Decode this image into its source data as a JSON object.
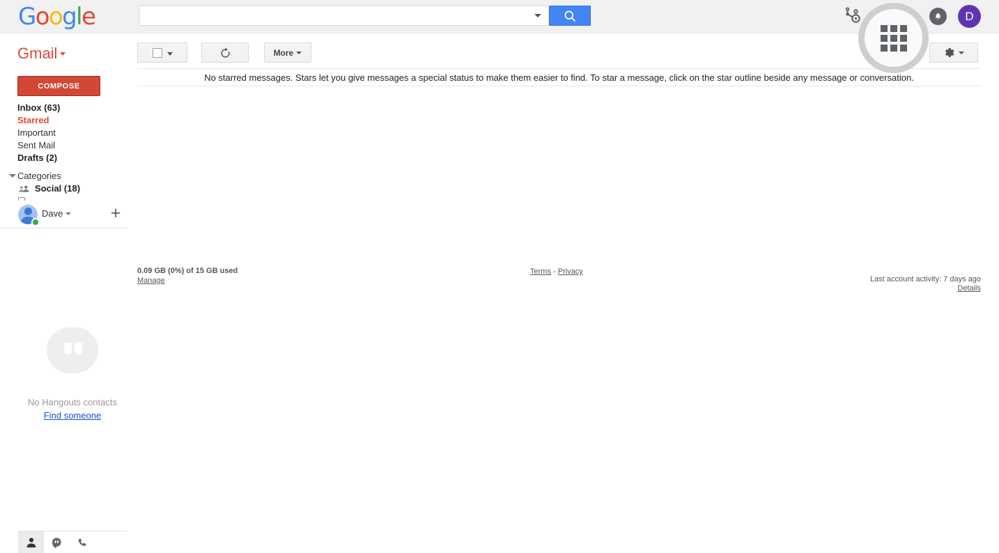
{
  "topbar": {
    "logo_text": "Google",
    "logo_letters": [
      "G",
      "o",
      "o",
      "g",
      "l",
      "e"
    ],
    "search": {
      "value": "",
      "placeholder": ""
    },
    "search_button_icon": "search-icon",
    "search_dropdown_icon": "chevron-down-icon",
    "hubspot_icon": "hubspot-sprocket-icon",
    "apps_icon": "apps-grid-icon",
    "notifications_icon": "bell-icon",
    "avatar_initial": "D",
    "accent_blue": "#4285f4",
    "avatar_color": "#5e35b1"
  },
  "brand": {
    "gmail_label": "Gmail",
    "gmail_color": "#dd4b39"
  },
  "toolbar": {
    "select_all_icon": "checkbox-icon",
    "select_all_caret": "chevron-down-icon",
    "refresh_icon": "refresh-icon",
    "more_label": "More",
    "settings_icon": "gear-icon"
  },
  "sidebar": {
    "compose_label": "COMPOSE",
    "items": [
      {
        "label": "Inbox (63)",
        "style": "bold"
      },
      {
        "label": "Starred",
        "style": "active"
      },
      {
        "label": "Important",
        "style": "normal"
      },
      {
        "label": "Sent Mail",
        "style": "normal"
      },
      {
        "label": "Drafts (2)",
        "style": "bold"
      }
    ],
    "categories_label": "Categories",
    "categories_children": [
      {
        "label": "Social (18)",
        "icon": "people-icon"
      }
    ],
    "hangouts_chip": {
      "name": "Dave",
      "status": "online",
      "avatar_icon": "person-avatar-icon",
      "caret_icon": "chevron-down-icon",
      "add_icon": "plus-icon"
    },
    "hangouts_empty": {
      "icon": "hangouts-bubble-icon",
      "text": "No Hangouts contacts",
      "link": "Find someone"
    },
    "tabs": [
      {
        "name": "contacts",
        "icon": "person-icon",
        "active": true
      },
      {
        "name": "conversations",
        "icon": "hangouts-icon",
        "active": false
      },
      {
        "name": "calls",
        "icon": "phone-icon",
        "active": false
      }
    ]
  },
  "main": {
    "empty_state_message": "No starred messages. Stars let you give messages a special status to make them easier to find. To star a message, click on the star outline beside any message or conversation."
  },
  "footer": {
    "storage": "0.09 GB (0%) of 15 GB used",
    "manage_label": "Manage",
    "terms_label": "Terms",
    "legal_separator": "-",
    "privacy_label": "Privacy",
    "activity": "Last account activity: 7 days ago",
    "details_label": "Details"
  }
}
